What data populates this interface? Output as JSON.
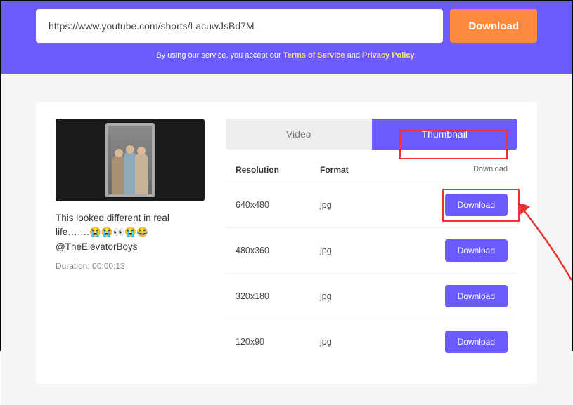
{
  "hero": {
    "url_value": "https://www.youtube.com/shorts/LacuwJsBd7M",
    "download_label": "Download",
    "disclaimer_prefix": "By using our service, you accept our ",
    "tos_label": "Terms of Service",
    "and_word": " and ",
    "pp_label": "Privacy Policy",
    "period": "."
  },
  "video": {
    "title": "This looked different in real life…….😭😭👀😭😂 @TheElevatorBoys",
    "duration_label": "Duration: 00:00:13"
  },
  "tabs": {
    "video": "Video",
    "thumbnail": "Thumbnail"
  },
  "table": {
    "headers": {
      "resolution": "Resolution",
      "format": "Format",
      "download": "Download"
    },
    "rows": [
      {
        "resolution": "640x480",
        "format": "jpg",
        "button": "Download"
      },
      {
        "resolution": "480x360",
        "format": "jpg",
        "button": "Download"
      },
      {
        "resolution": "320x180",
        "format": "jpg",
        "button": "Download"
      },
      {
        "resolution": "120x90",
        "format": "jpg",
        "button": "Download"
      }
    ]
  }
}
